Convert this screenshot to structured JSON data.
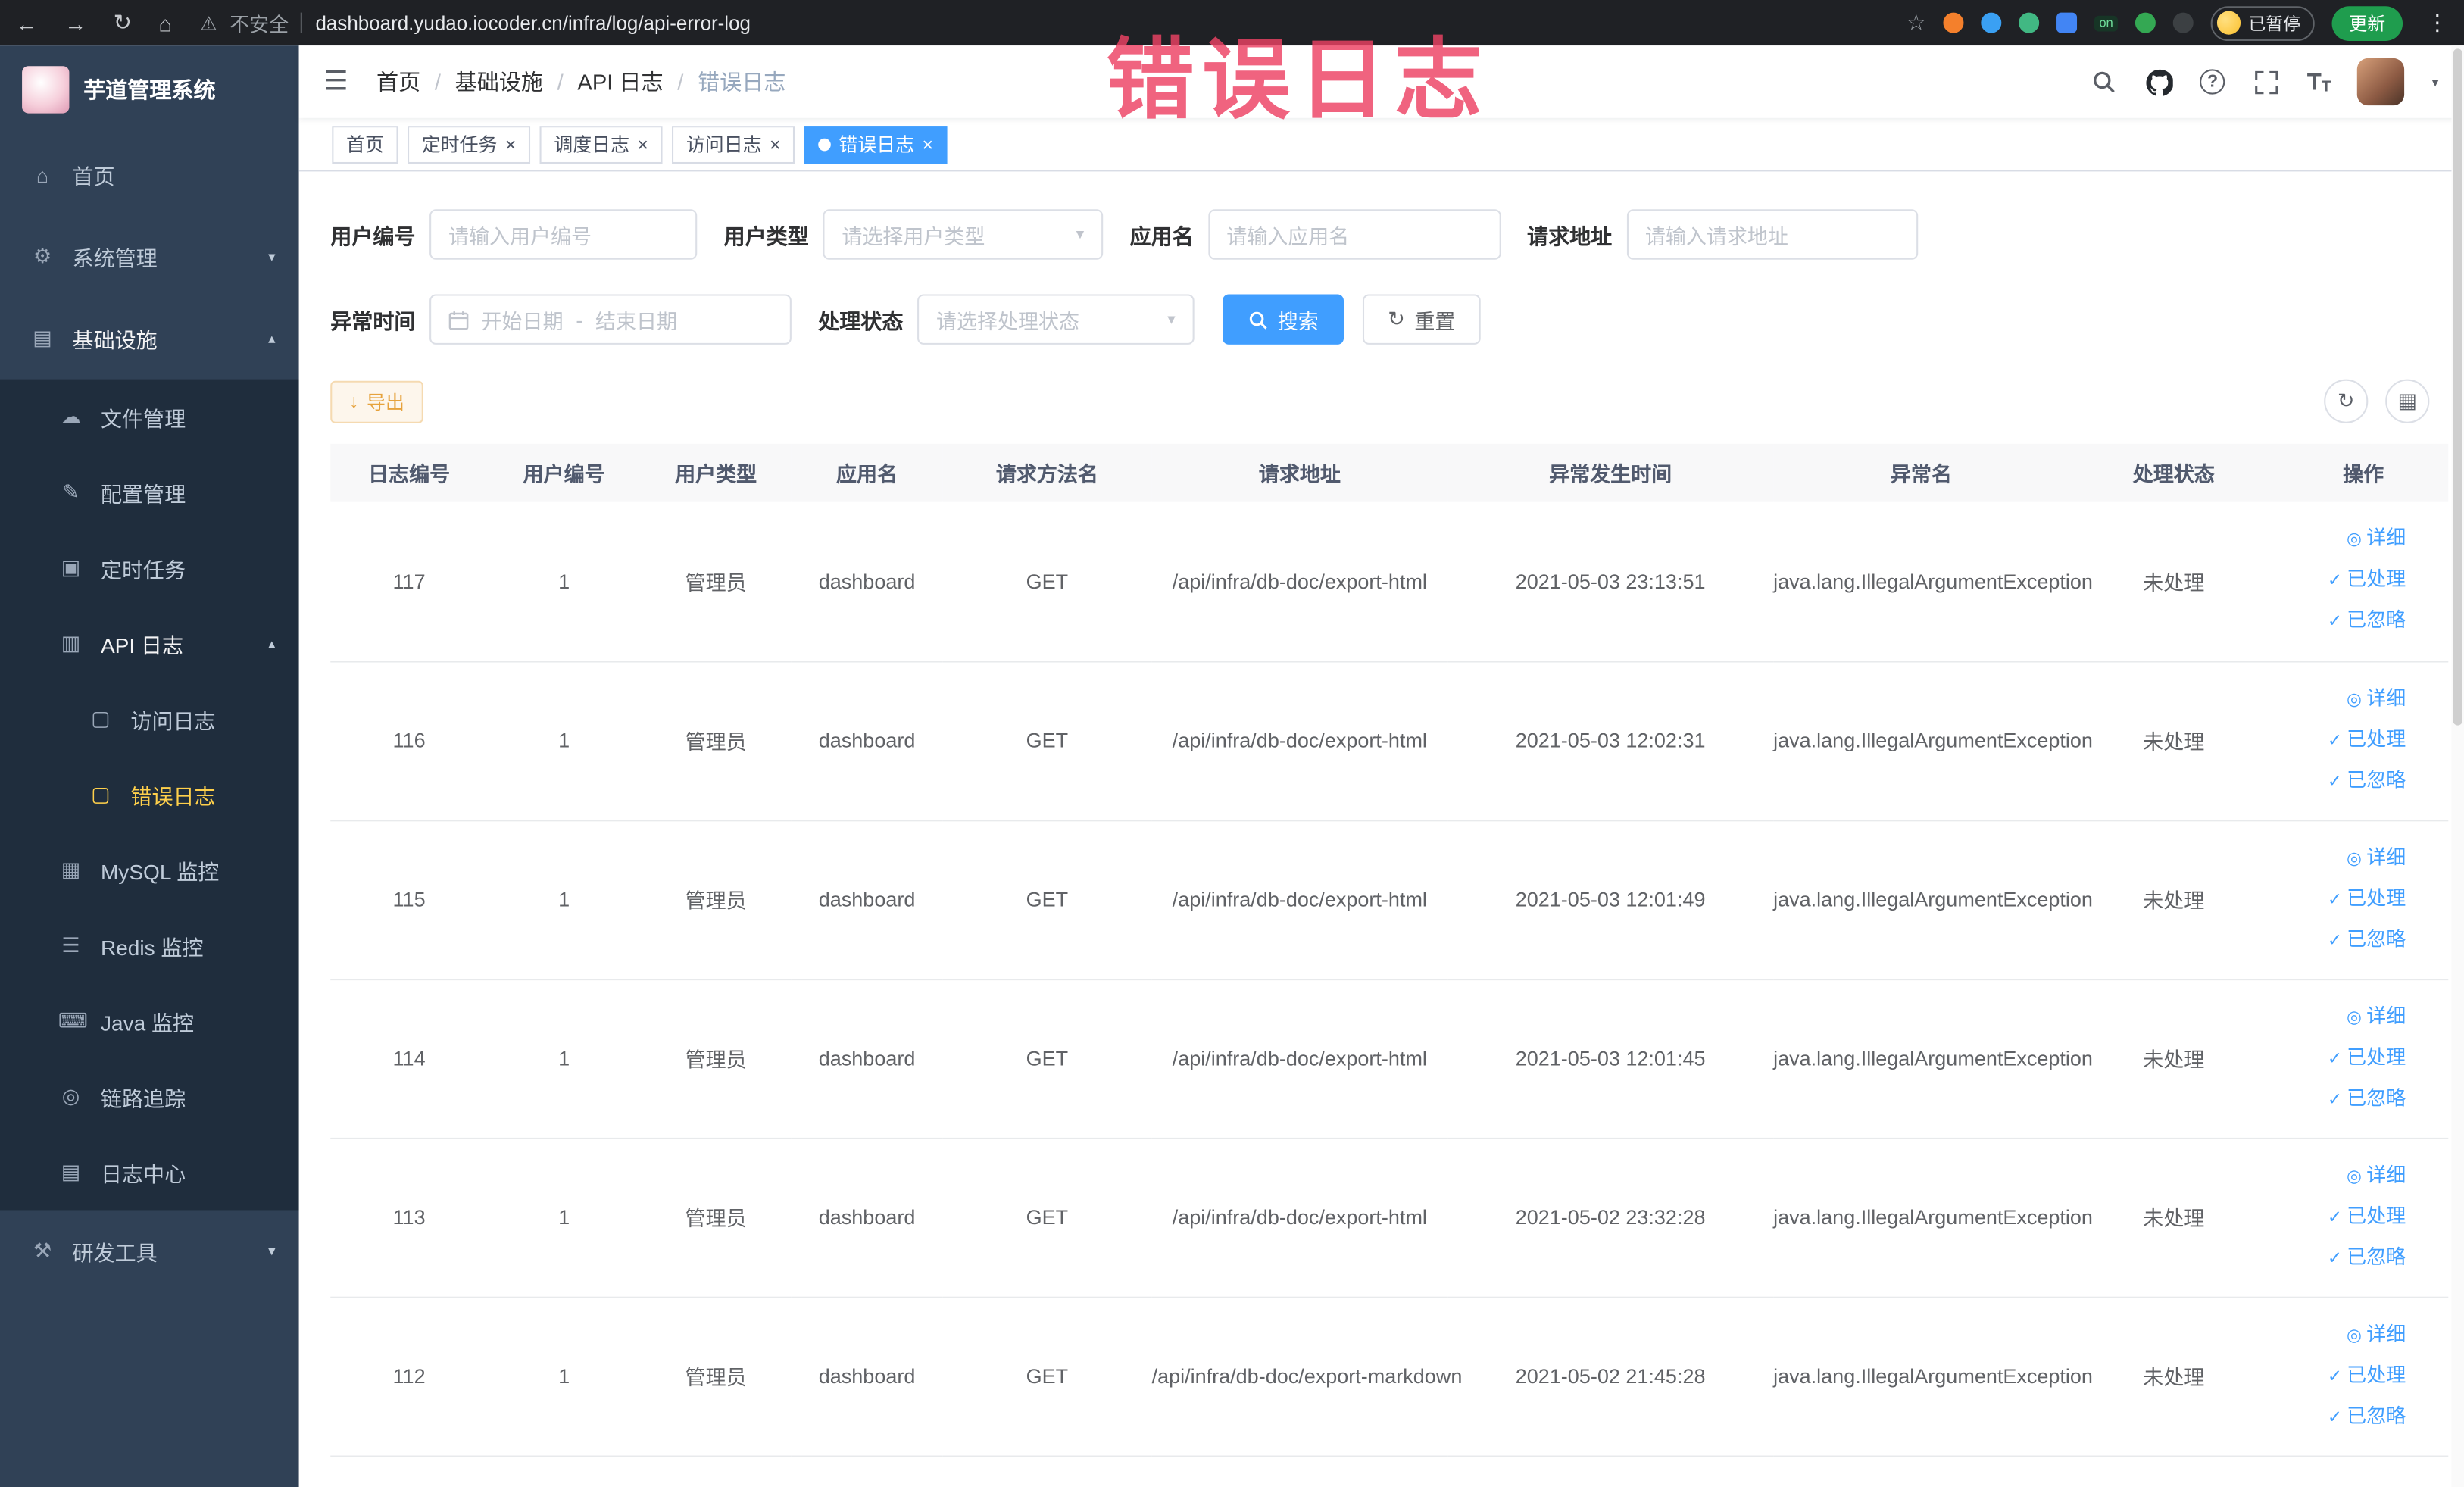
{
  "browser": {
    "security_label": "不安全",
    "url": "dashboard.yudao.iocoder.cn/infra/log/api-error-log",
    "on_badge": "on",
    "profile_chip": "已暂停",
    "update_button": "更新"
  },
  "annotation": {
    "text": "错误日志"
  },
  "sidebar": {
    "logo_title": "芋道管理系统",
    "items": [
      {
        "label": "首页",
        "glyph": "⌂"
      },
      {
        "label": "系统管理",
        "glyph": "⚙"
      },
      {
        "label": "基础设施",
        "glyph": "▤"
      },
      {
        "label": "文件管理",
        "glyph": "☁"
      },
      {
        "label": "配置管理",
        "glyph": "✎"
      },
      {
        "label": "定时任务",
        "glyph": "▣"
      },
      {
        "label": "API 日志",
        "glyph": "▥"
      },
      {
        "label": "访问日志",
        "glyph": "▢"
      },
      {
        "label": "错误日志",
        "glyph": "▢"
      },
      {
        "label": "MySQL 监控",
        "glyph": "▦"
      },
      {
        "label": "Redis 监控",
        "glyph": "☰"
      },
      {
        "label": "Java 监控",
        "glyph": "⌨"
      },
      {
        "label": "链路追踪",
        "glyph": "◎"
      },
      {
        "label": "日志中心",
        "glyph": "▤"
      },
      {
        "label": "研发工具",
        "glyph": "⚒"
      }
    ]
  },
  "header": {
    "breadcrumb": [
      "首页",
      "基础设施",
      "API 日志",
      "错误日志"
    ],
    "separator": "/"
  },
  "tabs": [
    {
      "label": "首页"
    },
    {
      "label": "定时任务"
    },
    {
      "label": "调度日志"
    },
    {
      "label": "访问日志"
    },
    {
      "label": "错误日志"
    }
  ],
  "filters": {
    "user_id": {
      "label": "用户编号",
      "placeholder": "请输入用户编号"
    },
    "user_type": {
      "label": "用户类型",
      "placeholder": "请选择用户类型"
    },
    "app_name": {
      "label": "应用名",
      "placeholder": "请输入应用名"
    },
    "request_url": {
      "label": "请求地址",
      "placeholder": "请输入请求地址"
    },
    "exception_time": {
      "label": "异常时间",
      "start_placeholder": "开始日期",
      "separator": "-",
      "end_placeholder": "结束日期"
    },
    "process_status": {
      "label": "处理状态",
      "placeholder": "请选择处理状态"
    },
    "search_button": "搜索",
    "reset_button": "重置"
  },
  "toolbar": {
    "export_button": "导出"
  },
  "table": {
    "columns": [
      "日志编号",
      "用户编号",
      "用户类型",
      "应用名",
      "请求方法名",
      "请求地址",
      "异常发生时间",
      "异常名",
      "处理状态",
      "操作"
    ],
    "rows": [
      {
        "id": "117",
        "user_id": "1",
        "user_type": "管理员",
        "app": "dashboard",
        "method": "GET",
        "url": "/api/infra/db-doc/export-html",
        "time": "2021-05-03 23:13:51",
        "exception": "java.lang.IllegalArgumentException",
        "status": "未处理"
      },
      {
        "id": "116",
        "user_id": "1",
        "user_type": "管理员",
        "app": "dashboard",
        "method": "GET",
        "url": "/api/infra/db-doc/export-html",
        "time": "2021-05-03 12:02:31",
        "exception": "java.lang.IllegalArgumentException",
        "status": "未处理"
      },
      {
        "id": "115",
        "user_id": "1",
        "user_type": "管理员",
        "app": "dashboard",
        "method": "GET",
        "url": "/api/infra/db-doc/export-html",
        "time": "2021-05-03 12:01:49",
        "exception": "java.lang.IllegalArgumentException",
        "status": "未处理"
      },
      {
        "id": "114",
        "user_id": "1",
        "user_type": "管理员",
        "app": "dashboard",
        "method": "GET",
        "url": "/api/infra/db-doc/export-html",
        "time": "2021-05-03 12:01:45",
        "exception": "java.lang.IllegalArgumentException",
        "status": "未处理"
      },
      {
        "id": "113",
        "user_id": "1",
        "user_type": "管理员",
        "app": "dashboard",
        "method": "GET",
        "url": "/api/infra/db-doc/export-html",
        "time": "2021-05-02 23:32:28",
        "exception": "java.lang.IllegalArgumentException",
        "status": "未处理"
      },
      {
        "id": "112",
        "user_id": "1",
        "user_type": "管理员",
        "app": "dashboard",
        "method": "GET",
        "url": "/api/infra/db-doc/export-markdown",
        "time": "2021-05-02 21:45:28",
        "exception": "java.lang.IllegalArgumentException",
        "status": "未处理"
      }
    ],
    "actions": {
      "detail": "详细",
      "processed": "已处理",
      "ignored": "已忽略"
    }
  },
  "icons": {
    "back": "←",
    "forward": "→",
    "reload": "↻",
    "home": "⌂",
    "warning": "⚠",
    "star": "☆",
    "kebab": "⋮",
    "menu": "☰",
    "close": "×",
    "chevron_down": "▾",
    "chevron_up": "▴",
    "select_arrow": "▾",
    "caret": "▾",
    "question": "?",
    "font_large": "T",
    "font_small": "T",
    "refresh": "↻",
    "grid_view": "▦",
    "download": "↓",
    "eye": "◎",
    "check": "✓"
  },
  "colors": {
    "accent": "#409eff",
    "sidebar_bg": "#304156",
    "submenu_bg": "#1f2d3d",
    "active_menu_text": "#ffd04b",
    "warning_button": "#e6a23c",
    "annotation": "#ed4264"
  }
}
